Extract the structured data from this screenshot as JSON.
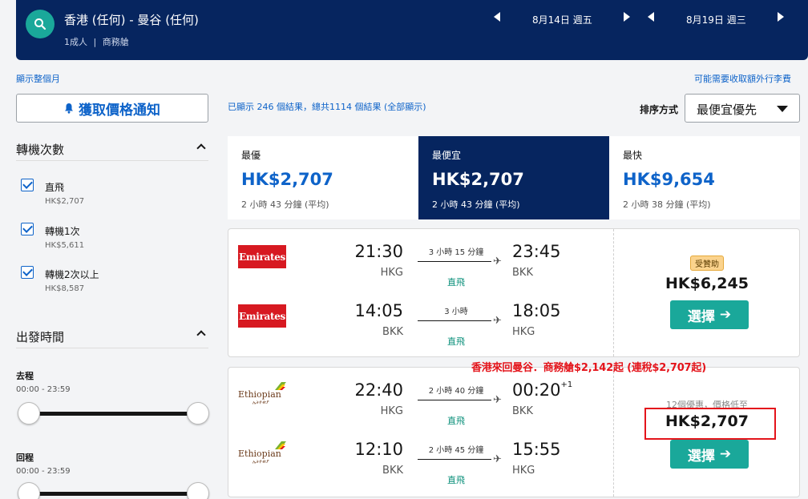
{
  "header": {
    "route": "香港 (任何) - 曼谷 (任何)",
    "passengers": "1成人",
    "cabin": "商務艙",
    "depart_date": "8月14日 週五",
    "return_date": "8月19日 週三"
  },
  "links": {
    "show_month": "顯示整個月",
    "baggage_fees": "可能需要收取額外行李費"
  },
  "sidebar": {
    "alert_button": "獲取價格通知",
    "stops_title": "轉機次數",
    "stops": [
      {
        "label": "直飛",
        "price": "HK$2,707",
        "checked": true
      },
      {
        "label": "轉機1次",
        "price": "HK$5,611",
        "checked": true
      },
      {
        "label": "轉機2次以上",
        "price": "HK$8,587",
        "checked": true
      }
    ],
    "departure_title": "出發時間",
    "outbound_label": "去程",
    "outbound_range": "00:00 - 23:59",
    "return_label": "回程",
    "return_range": "00:00 - 23:59"
  },
  "results": {
    "summary": "已顯示 246 個結果，總共1114 個結果 (全部顯示)",
    "sort_label": "排序方式",
    "sort_value": "最便宜優先"
  },
  "sort_tabs": [
    {
      "name": "最優",
      "price": "HK$2,707",
      "duration": "2 小時 43 分鐘 (平均)",
      "active": false
    },
    {
      "name": "最便宜",
      "price": "HK$2,707",
      "duration": "2 小時 43 分鐘 (平均)",
      "active": true
    },
    {
      "name": "最快",
      "price": "HK$9,654",
      "duration": "2 小時 38 分鐘 (平均)",
      "active": false
    }
  ],
  "cards": [
    {
      "airline": "Emirates",
      "legs": [
        {
          "dep_time": "21:30",
          "dep_code": "HKG",
          "duration": "3 小時 15 分鐘",
          "stops": "直飛",
          "arr_time": "23:45",
          "arr_code": "BKK",
          "next_day": ""
        },
        {
          "dep_time": "14:05",
          "dep_code": "BKK",
          "duration": "3 小時",
          "stops": "直飛",
          "arr_time": "18:05",
          "arr_code": "HKG",
          "next_day": ""
        }
      ],
      "badge": "受贊助",
      "deals": "",
      "price": "HK$6,245",
      "select_label": "選擇"
    },
    {
      "airline": "Ethiopian",
      "airline_script": "ኢትዮጵያ",
      "legs": [
        {
          "dep_time": "22:40",
          "dep_code": "HKG",
          "duration": "2 小時 40 分鐘",
          "stops": "直飛",
          "arr_time": "00:20",
          "arr_code": "BKK",
          "next_day": "+1"
        },
        {
          "dep_time": "12:10",
          "dep_code": "BKK",
          "duration": "2 小時 45 分鐘",
          "stops": "直飛",
          "arr_time": "15:55",
          "arr_code": "HKG",
          "next_day": ""
        }
      ],
      "badge": "",
      "deals": "12個優惠，價格低至",
      "price": "HK$2,707",
      "select_label": "選擇"
    }
  ],
  "annotation": {
    "promo_text": "香港來回曼谷．商務艙$2,142起 (連稅$2,707起)"
  },
  "colors": {
    "navy": "#06255f",
    "teal": "#1aa89a",
    "link_blue": "#0e63c9",
    "emirates_red": "#d71921",
    "annotation_red": "#e4141b"
  }
}
